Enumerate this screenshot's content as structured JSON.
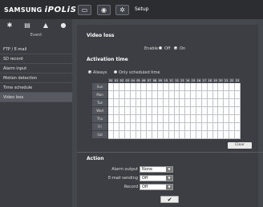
{
  "header": {
    "brand_main": "SAMSUNG",
    "brand_sub": "iPOLiS",
    "buttons": [
      {
        "icon": "monitor-icon",
        "glyph": "▭"
      },
      {
        "icon": "playback-icon",
        "glyph": "◉"
      },
      {
        "icon": "gear-icon",
        "glyph": "✲"
      }
    ],
    "title": "Setup"
  },
  "sidebar": {
    "tabs": [
      {
        "icon": "settings-icon",
        "glyph": "✱"
      },
      {
        "icon": "network-icon",
        "glyph": "▤"
      },
      {
        "icon": "event-icon",
        "glyph": "▲"
      },
      {
        "icon": "system-icon",
        "glyph": "●"
      }
    ],
    "section": "Event",
    "items": [
      {
        "label": "FTP / E-mail"
      },
      {
        "label": "SD record"
      },
      {
        "label": "Alarm input"
      },
      {
        "label": "Motion detection"
      },
      {
        "label": "Time schedule"
      },
      {
        "label": "Video loss",
        "active": true
      }
    ]
  },
  "video_loss": {
    "title": "Video loss",
    "enable_label": "Enable",
    "options": [
      "Off",
      "On"
    ],
    "selected": "On"
  },
  "activation": {
    "title": "Activation time",
    "options": [
      "Always",
      "Only scheduled time"
    ],
    "selected": "Always",
    "hours": [
      "00",
      "01",
      "02",
      "03",
      "04",
      "05",
      "06",
      "07",
      "08",
      "09",
      "10",
      "11",
      "12",
      "13",
      "14",
      "15",
      "16",
      "17",
      "18",
      "19",
      "20",
      "21",
      "22",
      "23"
    ],
    "days": [
      "Sun",
      "Mon",
      "Tue",
      "Wed",
      "Thu",
      "Fri",
      "Sat"
    ],
    "clear_label": "Clear"
  },
  "action": {
    "title": "Action",
    "fields": [
      {
        "label": "Alarm output",
        "value": "None"
      },
      {
        "label": "E-mail sending",
        "value": "Off"
      },
      {
        "label": "Record",
        "value": "Off"
      }
    ],
    "apply_glyph": "✔"
  }
}
